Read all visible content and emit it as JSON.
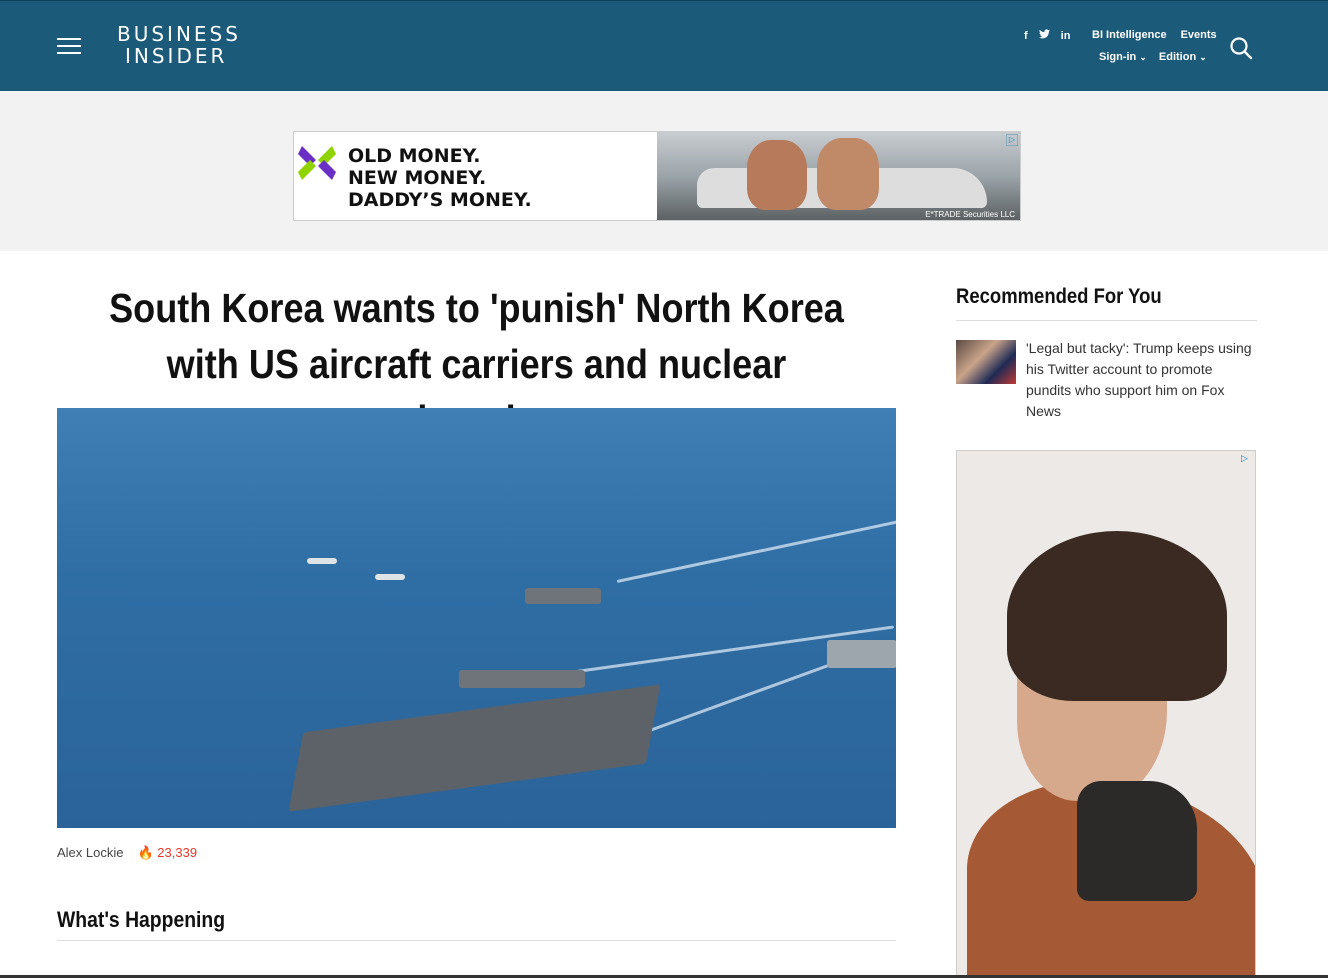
{
  "header": {
    "logo_line1": "BUSINESS",
    "logo_line2": "INSIDER",
    "social": {
      "facebook": "f",
      "twitter": "t",
      "linkedin": "in"
    },
    "links": {
      "bi_intelligence": "BI Intelligence",
      "events": "Events",
      "signin": "Sign-in",
      "edition": "Edition"
    }
  },
  "ad_banner": {
    "line1": "OLD MONEY.",
    "line2": "NEW MONEY.",
    "line3": "DADDY’S MONEY.",
    "credit": "E*TRADE Securities LLC"
  },
  "article": {
    "headline": "South Korea wants to 'punish' North Korea with US aircraft carriers and nuclear submarines",
    "author": "Alex Lockie",
    "views": "23,339"
  },
  "sections": {
    "whats_happening": "What's Happening"
  },
  "sidebar": {
    "title": "Recommended For You",
    "items": [
      {
        "text": "'Legal but tacky': Trump keeps using his Twitter account to promote pundits who support him on Fox News"
      }
    ]
  },
  "colors": {
    "header_bg": "#1c5a7a",
    "views_red": "#e03a2b"
  }
}
